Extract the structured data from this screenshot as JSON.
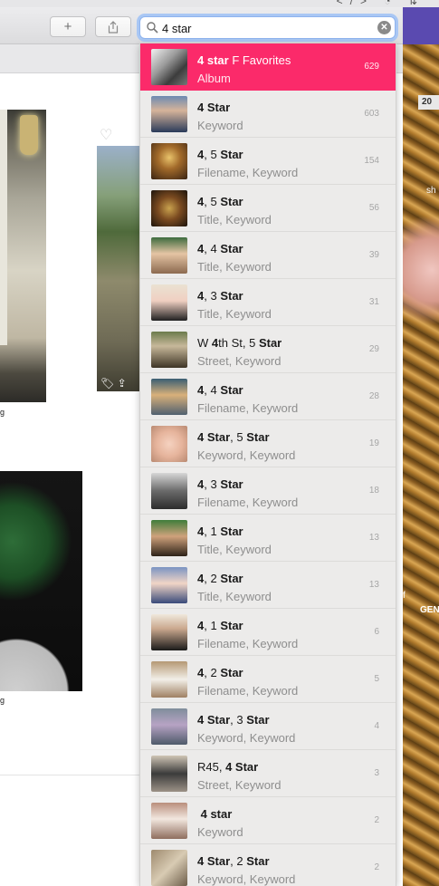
{
  "toolbar": {
    "add_icon": "plus-icon",
    "share_icon": "share-icon"
  },
  "search": {
    "value": "4 star",
    "icon": "search-icon",
    "clear_icon": "clear-icon"
  },
  "grid": {
    "tile_icons": [
      "heart-icon",
      "tag-icon",
      "share-icon"
    ]
  },
  "right_photo": {
    "badge": "20",
    "text1": "sh",
    "text2": "f",
    "text3": "GEN"
  },
  "accent_color": "#fb2a6a",
  "suggestions": [
    {
      "title_segments": [
        {
          "t": "4 star",
          "b": true
        },
        {
          "t": " F Favorites",
          "b": false
        }
      ],
      "subtitle": "Album",
      "count": "629",
      "selected": true
    },
    {
      "title_segments": [
        {
          "t": "4 Star",
          "b": true
        }
      ],
      "subtitle": "Keyword",
      "count": "603",
      "selected": false
    },
    {
      "title_segments": [
        {
          "t": "4",
          "b": true
        },
        {
          "t": ", 5 ",
          "b": false
        },
        {
          "t": "Star",
          "b": true
        }
      ],
      "subtitle": "Filename, Keyword",
      "count": "154",
      "selected": false
    },
    {
      "title_segments": [
        {
          "t": "4",
          "b": true
        },
        {
          "t": ", 5 ",
          "b": false
        },
        {
          "t": "Star",
          "b": true
        }
      ],
      "subtitle": "Title, Keyword",
      "count": "56",
      "selected": false
    },
    {
      "title_segments": [
        {
          "t": "4",
          "b": true
        },
        {
          "t": ", 4 ",
          "b": false
        },
        {
          "t": "Star",
          "b": true
        }
      ],
      "subtitle": "Title, Keyword",
      "count": "39",
      "selected": false
    },
    {
      "title_segments": [
        {
          "t": "4",
          "b": true
        },
        {
          "t": ", 3 ",
          "b": false
        },
        {
          "t": "Star",
          "b": true
        }
      ],
      "subtitle": "Title, Keyword",
      "count": "31",
      "selected": false
    },
    {
      "title_segments": [
        {
          "t": "W ",
          "b": false
        },
        {
          "t": "4",
          "b": true
        },
        {
          "t": "th St, 5 ",
          "b": false
        },
        {
          "t": "Star",
          "b": true
        }
      ],
      "subtitle": "Street, Keyword",
      "count": "29",
      "selected": false
    },
    {
      "title_segments": [
        {
          "t": "4",
          "b": true
        },
        {
          "t": ", 4 ",
          "b": false
        },
        {
          "t": "Star",
          "b": true
        }
      ],
      "subtitle": "Filename, Keyword",
      "count": "28",
      "selected": false
    },
    {
      "title_segments": [
        {
          "t": "4 Star",
          "b": true
        },
        {
          "t": ", 5 ",
          "b": false
        },
        {
          "t": "Star",
          "b": true
        }
      ],
      "subtitle": "Keyword, Keyword",
      "count": "19",
      "selected": false
    },
    {
      "title_segments": [
        {
          "t": "4",
          "b": true
        },
        {
          "t": ", 3 ",
          "b": false
        },
        {
          "t": "Star",
          "b": true
        }
      ],
      "subtitle": "Filename, Keyword",
      "count": "18",
      "selected": false
    },
    {
      "title_segments": [
        {
          "t": "4",
          "b": true
        },
        {
          "t": ", 1 ",
          "b": false
        },
        {
          "t": "Star",
          "b": true
        }
      ],
      "subtitle": "Title, Keyword",
      "count": "13",
      "selected": false
    },
    {
      "title_segments": [
        {
          "t": "4",
          "b": true
        },
        {
          "t": ", 2 ",
          "b": false
        },
        {
          "t": "Star",
          "b": true
        }
      ],
      "subtitle": "Title, Keyword",
      "count": "13",
      "selected": false
    },
    {
      "title_segments": [
        {
          "t": "4",
          "b": true
        },
        {
          "t": ", 1 ",
          "b": false
        },
        {
          "t": "Star",
          "b": true
        }
      ],
      "subtitle": "Filename, Keyword",
      "count": "6",
      "selected": false
    },
    {
      "title_segments": [
        {
          "t": "4",
          "b": true
        },
        {
          "t": ", 2 ",
          "b": false
        },
        {
          "t": "Star",
          "b": true
        }
      ],
      "subtitle": "Filename, Keyword",
      "count": "5",
      "selected": false
    },
    {
      "title_segments": [
        {
          "t": "4 Star",
          "b": true
        },
        {
          "t": ", 3 ",
          "b": false
        },
        {
          "t": "Star",
          "b": true
        }
      ],
      "subtitle": "Keyword, Keyword",
      "count": "4",
      "selected": false
    },
    {
      "title_segments": [
        {
          "t": "R45, ",
          "b": false
        },
        {
          "t": "4 Star",
          "b": true
        }
      ],
      "subtitle": "Street, Keyword",
      "count": "3",
      "selected": false
    },
    {
      "title_segments": [
        {
          "t": " 4 star",
          "b": true
        }
      ],
      "subtitle": "Keyword",
      "count": "2",
      "selected": false
    },
    {
      "title_segments": [
        {
          "t": "4 Star",
          "b": true
        },
        {
          "t": ", 2 ",
          "b": false
        },
        {
          "t": "Star",
          "b": true
        }
      ],
      "subtitle": "Keyword, Keyword",
      "count": "2",
      "selected": false
    }
  ]
}
